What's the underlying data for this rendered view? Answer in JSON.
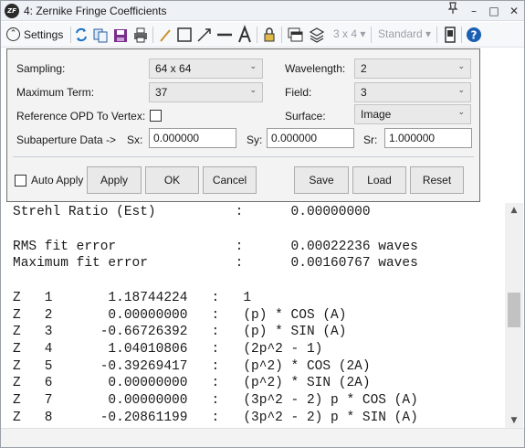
{
  "window": {
    "title": "4: Zernike Fringe Coefficients",
    "logo_text": "ZF",
    "controls": [
      "–",
      "□",
      "✕"
    ],
    "pin_icon": "pin-icon"
  },
  "toolbar": {
    "settings_label": "Settings",
    "layout_dropdown": "3 x 4 ▾",
    "standard_dropdown": "Standard ▾",
    "icons": [
      "refresh-icon",
      "copy-icon",
      "save-icon",
      "print-icon",
      "pencil-icon",
      "rectangle-icon",
      "arrow-icon",
      "line-icon",
      "text-icon",
      "lock-icon",
      "window-icon",
      "layers-icon",
      "panel-icon",
      "help-icon"
    ]
  },
  "settings": {
    "sampling_label": "Sampling:",
    "sampling_value": "64 x 64",
    "max_term_label": "Maximum Term:",
    "max_term_value": "37",
    "ref_opd_label": "Reference OPD To Vertex:",
    "ref_opd_checked": false,
    "subaperture_label": "Subaperture Data ->",
    "sx_label": "Sx:",
    "sx_value": "0.000000",
    "sy_label": "Sy:",
    "sy_value": "0.000000",
    "sr_label": "Sr:",
    "sr_value": "1.000000",
    "wavelength_label": "Wavelength:",
    "wavelength_value": "2",
    "field_label": "Field:",
    "field_value": "3",
    "surface_label": "Surface:",
    "surface_value": "Image",
    "auto_apply_label": "Auto Apply",
    "auto_apply_checked": false,
    "buttons": {
      "apply": "Apply",
      "ok": "OK",
      "cancel": "Cancel",
      "save": "Save",
      "load": "Load",
      "reset": "Reset"
    }
  },
  "output": {
    "lines": [
      "Strehl Ratio (Est)          :      0.00000000",
      "",
      "RMS fit error               :      0.00022236 waves",
      "Maximum fit error           :      0.00160767 waves",
      "",
      "Z   1       1.18744224   :   1",
      "Z   2       0.00000000   :   (p) * COS (A)",
      "Z   3      -0.66726392   :   (p) * SIN (A)",
      "Z   4       1.04010806   :   (2p^2 - 1)",
      "Z   5      -0.39269417   :   (p^2) * COS (2A)",
      "Z   6       0.00000000   :   (p^2) * SIN (2A)",
      "Z   7       0.00000000   :   (3p^2 - 2) p * COS (A)",
      "Z   8      -0.20861199   :   (3p^2 - 2) p * SIN (A)"
    ]
  },
  "colors": {
    "accent": "#1a6fd1",
    "refresh": "#1a73c9",
    "save": "#7b2d8e",
    "help": "#1a5fb4"
  }
}
